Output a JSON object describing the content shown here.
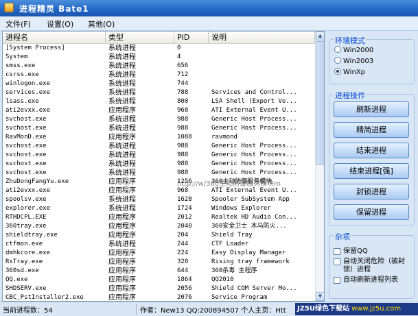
{
  "window": {
    "title": "进程精灵 Bate1"
  },
  "menu": [
    "文件(F)",
    "设置(O)",
    "其他(O)"
  ],
  "columns": [
    "进程名",
    "类型",
    "PID",
    "说明"
  ],
  "rows": [
    [
      "[System Process]",
      "系统进程",
      "0",
      ""
    ],
    [
      "System",
      "系统进程",
      "4",
      ""
    ],
    [
      "smss.exe",
      "系统进程",
      "656",
      ""
    ],
    [
      "csrss.exe",
      "系统进程",
      "712",
      ""
    ],
    [
      "winlogon.exe",
      "系统进程",
      "744",
      ""
    ],
    [
      "services.exe",
      "系统进程",
      "788",
      "Services and Control..."
    ],
    [
      "lsass.exe",
      "系统进程",
      "800",
      "LSA Shell (Export Ve..."
    ],
    [
      "ati2evxx.exe",
      "应用程序",
      "968",
      "ATI External Event U..."
    ],
    [
      "svchost.exe",
      "系统进程",
      "988",
      "Generic Host Process..."
    ],
    [
      "svchost.exe",
      "系统进程",
      "988",
      "Generic Host Process..."
    ],
    [
      "RavMonD.exe",
      "应用程序",
      "1088",
      "ravmond"
    ],
    [
      "svchost.exe",
      "系统进程",
      "988",
      "Generic Host Process..."
    ],
    [
      "svchost.exe",
      "系统进程",
      "988",
      "Generic Host Process..."
    ],
    [
      "svchost.exe",
      "系统进程",
      "988",
      "Generic Host Process..."
    ],
    [
      "svchost.exe",
      "系统进程",
      "988",
      "Generic Host Process..."
    ],
    [
      "ZhuDongFangYu.exe",
      "应用程序",
      "1256",
      "360主动防御服务模块"
    ],
    [
      "ati2evxx.exe",
      "应用程序",
      "968",
      "ATI External Event U..."
    ],
    [
      "spoolsv.exe",
      "系统进程",
      "1628",
      "Spooler SubSystem App"
    ],
    [
      "explorer.exe",
      "系统进程",
      "1724",
      "Windows Explorer"
    ],
    [
      "RTHDCPL.EXE",
      "应用程序",
      "2012",
      "Realtek HD Audio Con..."
    ],
    [
      "360tray.exe",
      "应用程序",
      "2040",
      "360安全卫士 木马防火..."
    ],
    [
      "shieldtray.exe",
      "应用程序",
      "204",
      "Shield Tray"
    ],
    [
      "ctfmon.exe",
      "系统进程",
      "244",
      "CTF Loader"
    ],
    [
      "dmhkcore.exe",
      "应用程序",
      "224",
      "Easy Display Manager"
    ],
    [
      "RsTray.exe",
      "应用程序",
      "328",
      "Rising tray framework"
    ],
    [
      "360sd.exe",
      "应用程序",
      "644",
      "360杀毒 主程序"
    ],
    [
      "QQ.exe",
      "应用程序",
      "1864",
      "QQ2010"
    ],
    [
      "SHDSERV.exe",
      "应用程序",
      "2056",
      "Shield COM Server Mo..."
    ],
    [
      "CBC_PstInstaller2.exe",
      "应用程序",
      "2076",
      "Service Program"
    ]
  ],
  "overlay_text": "http://w/360主动防御服务模块m",
  "env": {
    "title": "环境模式",
    "options": [
      "Win2000",
      "Win2003",
      "WinXp"
    ],
    "selected": "WinXp"
  },
  "ops": {
    "title": "进程操作",
    "buttons": [
      "刷新进程",
      "精简进程",
      "结束进程",
      "结束进程[强]",
      "封锁进程",
      "保留进程"
    ]
  },
  "misc": {
    "title": "杂项",
    "checks": [
      "保留QQ",
      "自动关闭危险（被封锁）进程",
      "自动刷新进程列表"
    ]
  },
  "status": {
    "count": "当前进程数：54",
    "author": "作者：New13 QQ:200894507  个人主页：Htt"
  },
  "watermark": {
    "brand": "JZ5U绿色下载站",
    "url": "www.jz5u.com"
  }
}
